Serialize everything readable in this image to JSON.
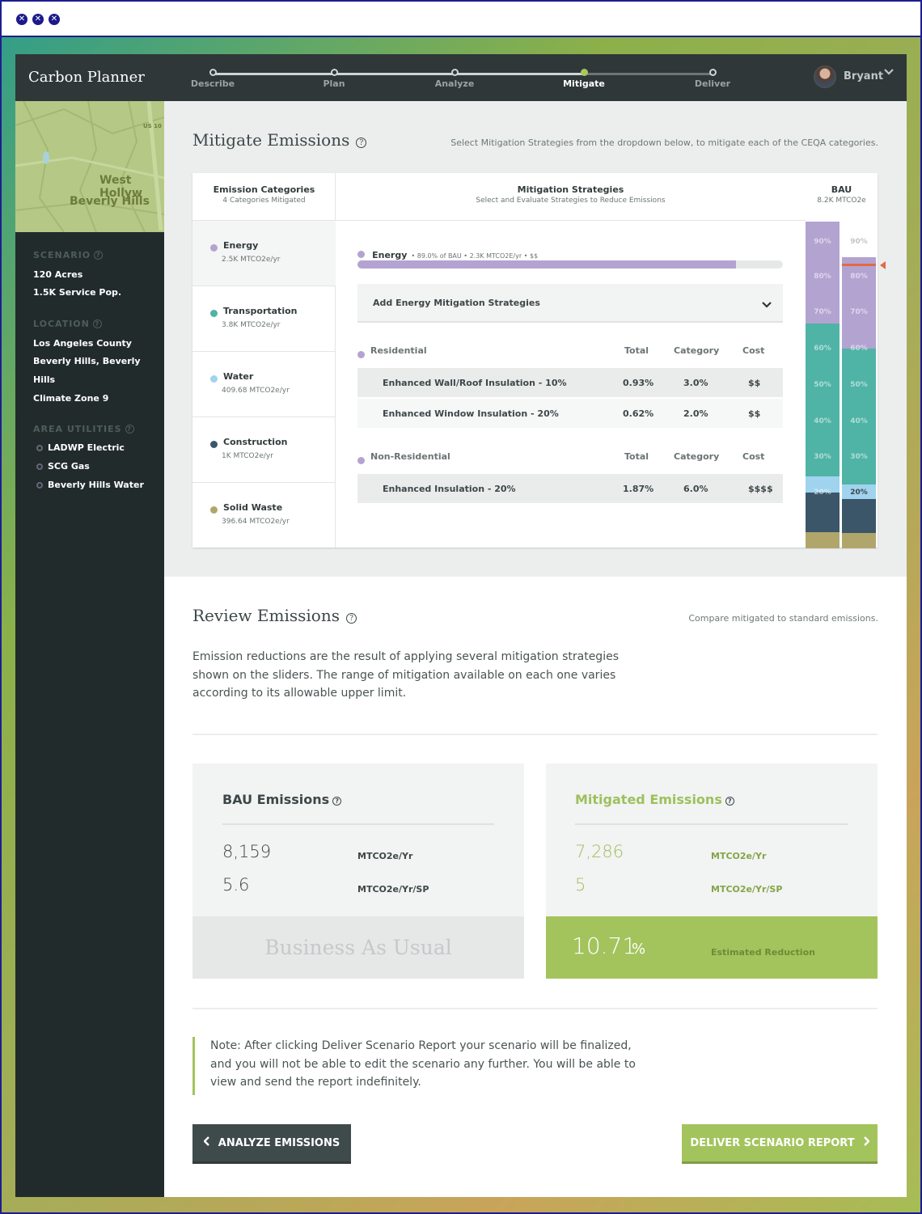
{
  "app": {
    "title": "Carbon Planner"
  },
  "steps": [
    {
      "label": "Describe"
    },
    {
      "label": "Plan"
    },
    {
      "label": "Analyze"
    },
    {
      "label": "Mitigate"
    },
    {
      "label": "Deliver"
    }
  ],
  "user": {
    "name": "Bryant"
  },
  "map": {
    "label1": "West Hollyw",
    "label2": "Beverly Hills",
    "label3": "US 10"
  },
  "sidebar": {
    "scenario_h": "SCENARIO",
    "acres": "120 Acres",
    "pop": "1.5K Service Pop.",
    "location_h": "LOCATION",
    "county": "Los Angeles County",
    "city1": "Beverly Hills, Beverly",
    "city2": "Hills",
    "zone": "Climate Zone 9",
    "util_h": "AREA UTILITIES",
    "utilities": [
      "LADWP Electric",
      "SCG Gas",
      "Beverly Hills Water"
    ]
  },
  "mitigate": {
    "title": "Mitigate Emissions",
    "subtitle": "Select Mitigation Strategies from the dropdown below, to mitigate each of the CEQA categories.",
    "cat_h": "Emission Categories",
    "cat_s": "4 Categories Mitigated",
    "strat_h": "Mitigation Strategies",
    "strat_s": "Select and Evaluate Strategies to Reduce Emissions",
    "bau_h": "BAU",
    "bau_s": "8.2K MTCO2e",
    "categories": [
      {
        "name": "Energy",
        "value": "2.5K MTCO2e/yr",
        "color": "#b3a3d1"
      },
      {
        "name": "Transportation",
        "value": "3.8K MTCO2e/yr",
        "color": "#4fb3a6"
      },
      {
        "name": "Water",
        "value": "409.68 MTCO2e/yr",
        "color": "#9fd3ee"
      },
      {
        "name": "Construction",
        "value": "1K MTCO2e/yr",
        "color": "#3b5668"
      },
      {
        "name": "Solid Waste",
        "value": "396.64 MTCO2e/yr",
        "color": "#b0a66c"
      }
    ],
    "energy_label": "Energy",
    "energy_meta": "• 89.0% of BAU • 2.3K MTCO2E/yr • $$",
    "energy_progress": 0.89,
    "dropdown": "Add Energy Mitigation Strategies",
    "res_h": "Residential",
    "nonres_h": "Non-Residential",
    "col_total": "Total",
    "col_cat": "Category",
    "col_cost": "Cost",
    "residential": [
      {
        "name": "Enhanced Wall/Roof Insulation - 10%",
        "total": "0.93%",
        "category": "3.0%",
        "cost": "$$"
      },
      {
        "name": "Enhanced Window Insulation - 20%",
        "total": "0.62%",
        "category": "2.0%",
        "cost": "$$"
      }
    ],
    "nonresidential": [
      {
        "name": "Enhanced Insulation - 20%",
        "total": "1.87%",
        "category": "6.0%",
        "cost": "$$$$"
      }
    ],
    "ticks": [
      "90%",
      "80%",
      "70%",
      "60%",
      "50%",
      "40%",
      "30%",
      "20%"
    ]
  },
  "review": {
    "title": "Review Emissions",
    "subtitle": "Compare mitigated to standard emissions.",
    "para": "Emission reductions are the result of applying several mitigation strategies shown on the sliders. The range of mitigation available on each one varies according to its allowable upper limit.",
    "bau_title": "BAU Emissions",
    "bau_v1": "8,159",
    "bau_u1": "MTCO2e/Yr",
    "bau_v2": "5.6",
    "bau_u2": "MTCO2e/Yr/SP",
    "bau_footer": "Business As Usual",
    "mit_title": "Mitigated Emissions",
    "mit_v1": "7,286",
    "mit_u1": "MTCO2e/Yr",
    "mit_v2": "5",
    "mit_u2": "MTCO2e/Yr/SP",
    "reduction": "10.71",
    "reduction_unit": "%",
    "reduction_label": "Estimated Reduction",
    "note": "Note: After clicking Deliver Scenario Report your scenario will be finalized, and you will not be able to edit the scenario any further. You will be able to view and send the report indefinitely.",
    "back_btn": "ANALYZE EMISSIONS",
    "deliver_btn": "DELIVER SCENARIO REPORT"
  }
}
